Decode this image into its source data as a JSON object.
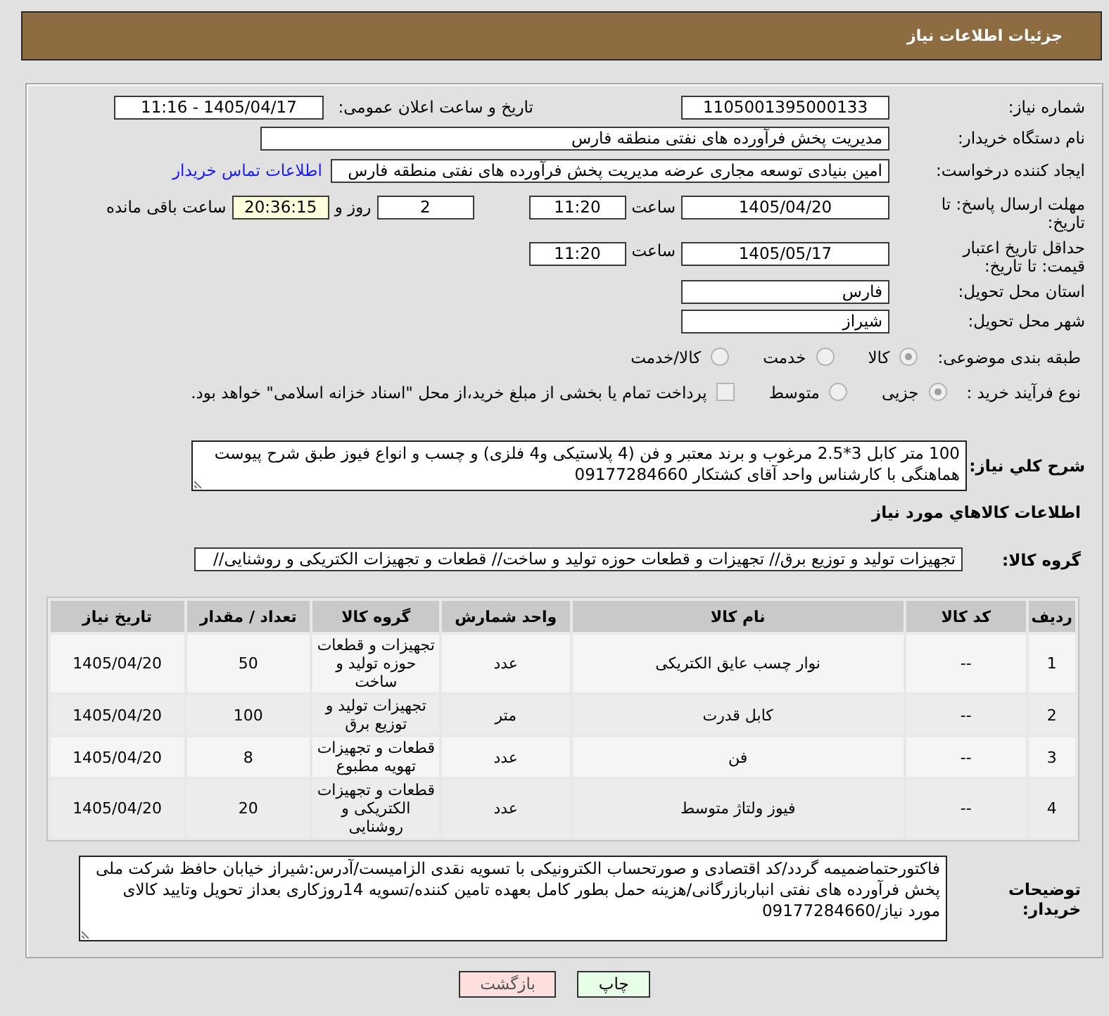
{
  "header": {
    "title": "جزئیات اطلاعات نیاز"
  },
  "form": {
    "need_number": {
      "label": "شماره نیاز:",
      "value": "1105001395000133"
    },
    "announce_datetime": {
      "label": "تاریخ و ساعت اعلان عمومی:",
      "value": "1405/04/17 - 11:16"
    },
    "buyer_org": {
      "label": "نام دستگاه خریدار:",
      "value": "مدیریت پخش فرآورده های نفتی منطقه فارس"
    },
    "requester": {
      "label": "ایجاد کننده درخواست:",
      "value": "امین بنیادی توسعه مجاری عرضه مدیریت پخش فرآورده های نفتی منطقه فارس",
      "link": "اطلاعات تماس خریدار"
    },
    "response_deadline": {
      "label": "مهلت ارسال پاسخ: تا تاریخ:",
      "date": "1405/04/20",
      "time_label": "ساعت",
      "time": "11:20",
      "days": "2",
      "days_label": "روز و",
      "remaining": "20:36:15",
      "remaining_label": "ساعت باقی مانده"
    },
    "price_validity": {
      "label": "حداقل تاریخ اعتبار قیمت: تا تاریخ:",
      "date": "1405/05/17",
      "time_label": "ساعت",
      "time": "11:20"
    },
    "delivery_province": {
      "label": "استان محل تحویل:",
      "value": "فارس"
    },
    "delivery_city": {
      "label": "شهر محل تحویل:",
      "value": "شیراز"
    },
    "category": {
      "label": "طبقه بندی موضوعی:",
      "options": [
        {
          "label": "کالا",
          "selected": true
        },
        {
          "label": "خدمت",
          "selected": false
        },
        {
          "label": "کالا/خدمت",
          "selected": false
        }
      ]
    },
    "purchase_type": {
      "label": "نوع فرآیند خرید :",
      "options": [
        {
          "label": "جزیی",
          "selected": true
        },
        {
          "label": "متوسط",
          "selected": false
        }
      ],
      "treasury_payment": {
        "label": "پرداخت تمام یا بخشی از مبلغ خرید،از محل \"اسناد خزانه اسلامی\" خواهد بود.",
        "checked": false
      }
    }
  },
  "description": {
    "label": "شرح کلي نیاز:",
    "value": "100 متر کابل 3*2.5 مرغوب و برند معتبر و فن (4 پلاستیکی و4 فلزی) و چسب و انواع فیوز طبق شرح پیوست هماهنگی با کارشناس واحد آقای کشتکار 09177284660"
  },
  "goods_section": {
    "title": "اطلاعات کالاهاي مورد نیاز",
    "group_label": "گروه کالا:",
    "group_value": "تجهیزات تولید و توزیع برق// تجهیزات و قطعات حوزه تولید و ساخت// قطعات و تجهیزات الکتریکی و روشنایی//"
  },
  "table": {
    "columns": [
      "ردیف",
      "کد کالا",
      "نام کالا",
      "واحد شمارش",
      "گروه کالا",
      "تعداد / مقدار",
      "تاریخ نیاز"
    ],
    "rows": [
      {
        "cells": [
          "1",
          "--",
          "نوار چسب عایق الکتریکی",
          "عدد",
          "تجهیزات و قطعات حوزه تولید و ساخت",
          "50",
          "1405/04/20"
        ]
      },
      {
        "cells": [
          "2",
          "--",
          "کابل قدرت",
          "متر",
          "تجهیزات تولید و توزیع برق",
          "100",
          "1405/04/20"
        ]
      },
      {
        "cells": [
          "3",
          "--",
          "فن",
          "عدد",
          "قطعات و تجهیزات تهویه مطبوع",
          "8",
          "1405/04/20"
        ]
      },
      {
        "cells": [
          "4",
          "--",
          "فیوز ولتاژ متوسط",
          "عدد",
          "قطعات و تجهیزات الکتریکی و روشنایی",
          "20",
          "1405/04/20"
        ]
      }
    ]
  },
  "buyer_notes": {
    "label": "توضیحات خریدار:",
    "value": "فاکتورحتماضمیمه گردد/کد اقتصادی و صورتحساب الکترونیکی با تسویه نقدی الزامیست/آدرس:شیراز خیابان حافظ شرکت ملی پخش فرآورده های نفتی انباربازرگانی/هزینه حمل بطور کامل بعهده تامین کننده/تسویه 14روزکاری بعداز تحویل وتایید کالای مورد نیاز/09177284660"
  },
  "buttons": [
    {
      "label": "چاپ",
      "kind": "print"
    },
    {
      "label": "بازگشت",
      "kind": "back"
    }
  ]
}
